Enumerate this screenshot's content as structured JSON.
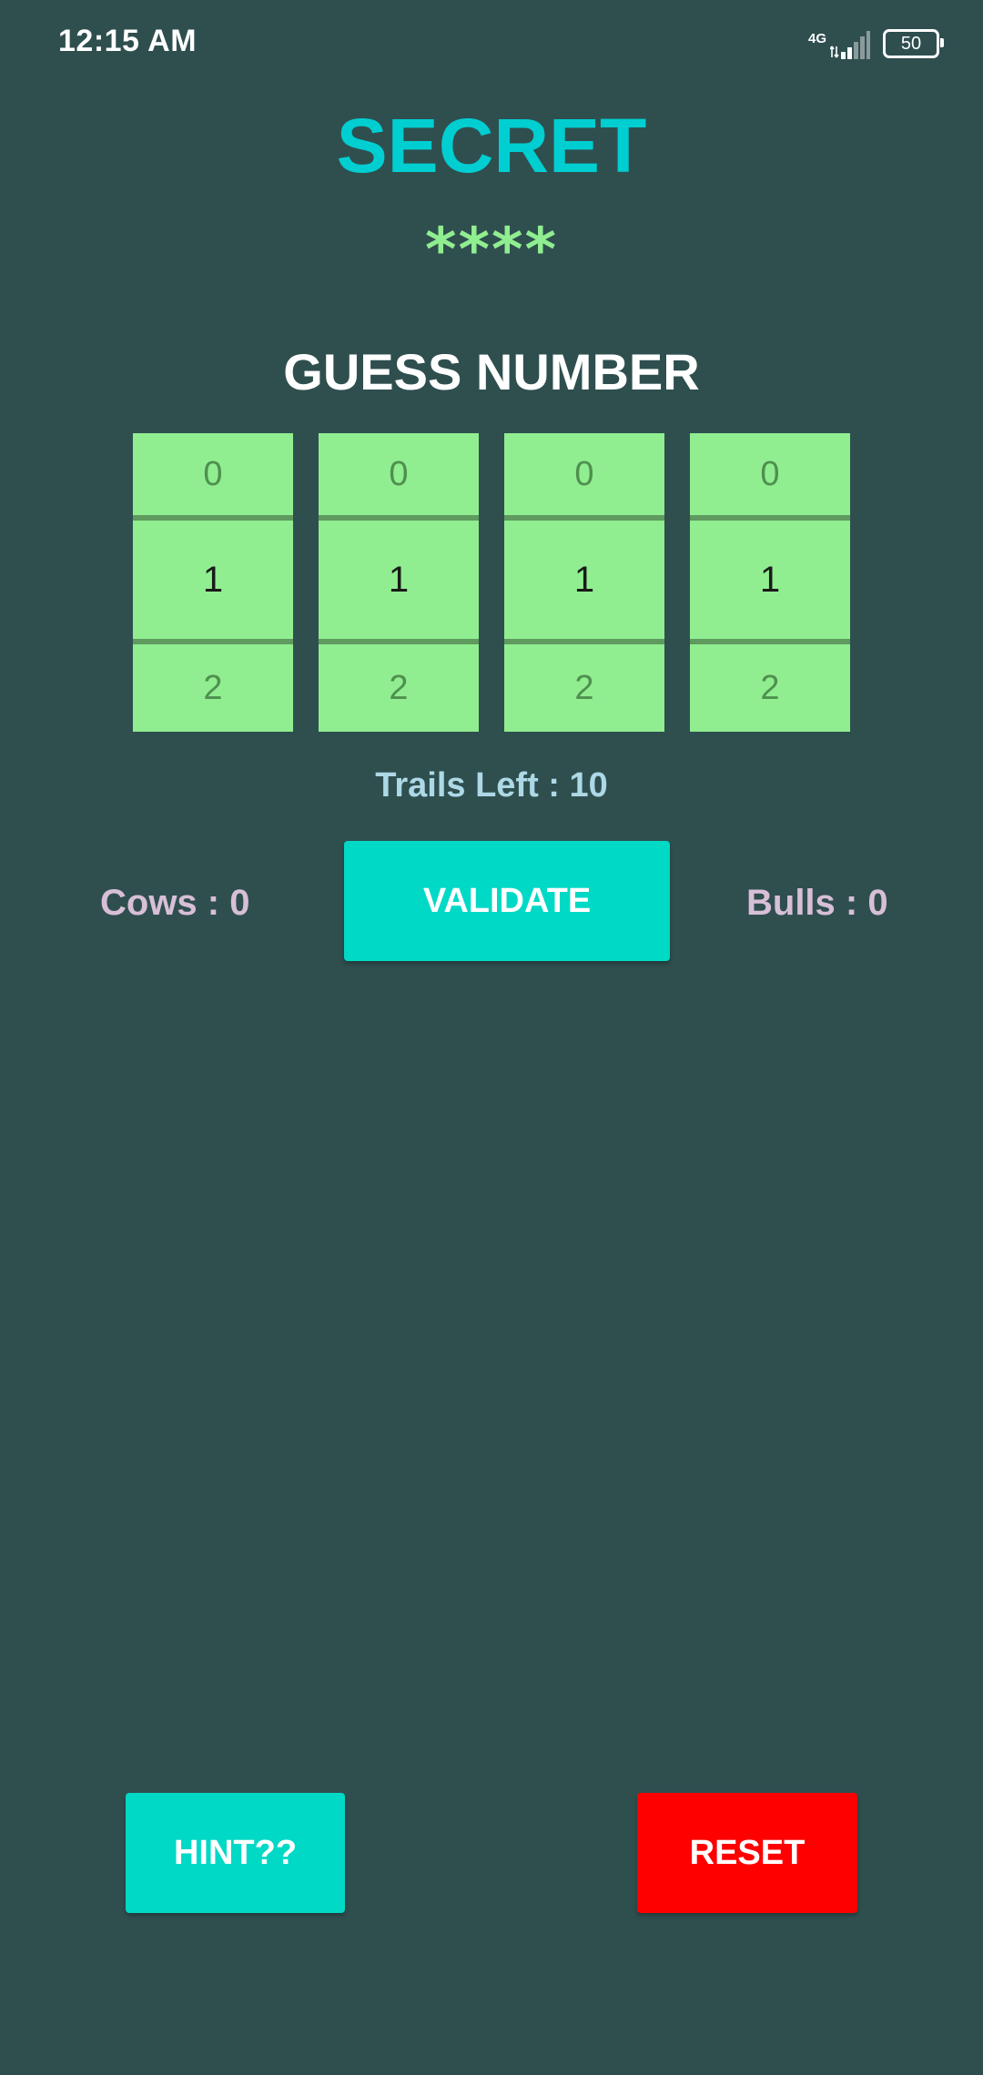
{
  "status_bar": {
    "time": "12:15 AM",
    "network": "4G",
    "battery": "50"
  },
  "header": {
    "title": "SECRET",
    "masked_secret": "****"
  },
  "guess": {
    "title": "GUESS NUMBER",
    "pickers": [
      {
        "prev": "0",
        "current": "1",
        "next": "2"
      },
      {
        "prev": "0",
        "current": "1",
        "next": "2"
      },
      {
        "prev": "0",
        "current": "1",
        "next": "2"
      },
      {
        "prev": "0",
        "current": "1",
        "next": "2"
      }
    ]
  },
  "trails_left": "Trails Left : 10",
  "result": {
    "cows": "Cows : 0",
    "bulls": "Bulls : 0"
  },
  "buttons": {
    "validate": "VALIDATE",
    "hint": "HINT??",
    "reset": "RESET"
  },
  "colors": {
    "background": "#2f4f4f",
    "title": "#00ced1",
    "masked_secret": "#90ee90",
    "picker_bg": "#90ee90",
    "trails_text": "#add8e6",
    "score_text": "#d8bfd8",
    "primary_button": "#00d9c5",
    "reset_button": "#ff0000"
  }
}
